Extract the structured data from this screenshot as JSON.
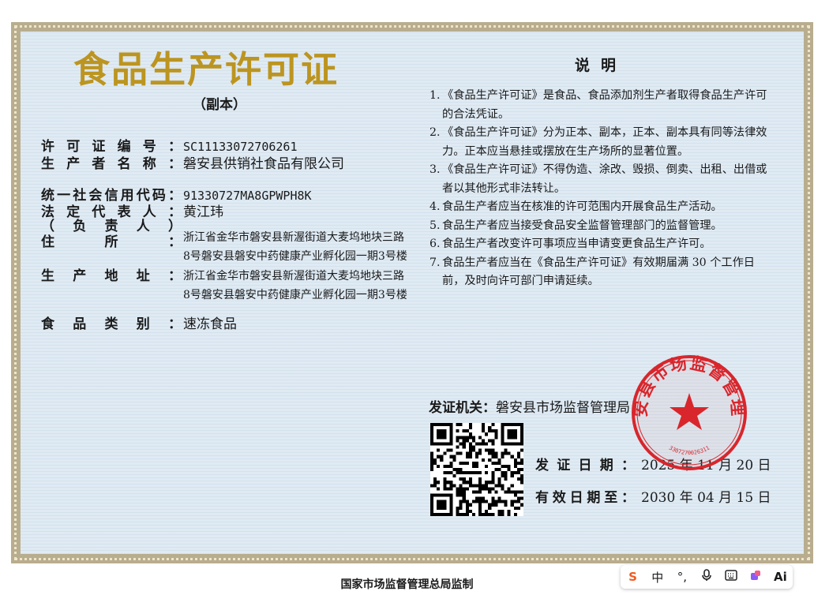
{
  "title": "食品生产许可证",
  "copy_label": "（副本）",
  "fields": [
    {
      "label": "许可证编号：",
      "value": "SC11133072706261"
    },
    {
      "label": "生产者名称：",
      "value": "磐安县供销社食品有限公司"
    },
    {
      "label": "统一社会信用代码：",
      "value": "91330727MA8GPWPH8K"
    },
    {
      "label": "法定代表人：",
      "value": "黄江玮"
    },
    {
      "label": "（负责人）",
      "value": ""
    },
    {
      "label": "住所：",
      "value_line1": "浙江省金华市磐安县新渥街道大麦坞地块三路",
      "value_line2": "8号磐安县磐安中药健康产业孵化园一期3号楼"
    },
    {
      "label": "生产地址：",
      "value_line1": "浙江省金华市磐安县新渥街道大麦坞地块三路",
      "value_line2": "8号磐安县磐安中药健康产业孵化园一期3号楼"
    },
    {
      "label": "食品类别：",
      "value": "速冻食品"
    }
  ],
  "notes_title": "说明",
  "notes": [
    {
      "num": "1.",
      "text": "《食品生产许可证》是食品、食品添加剂生产者取得食品生产许可的合法凭证。"
    },
    {
      "num": "2.",
      "text": "《食品生产许可证》分为正本、副本，正本、副本具有同等法律效力。正本应当悬挂或摆放在生产场所的显著位置。"
    },
    {
      "num": "3.",
      "text": "《食品生产许可证》不得伪造、涂改、毁损、倒卖、出租、出借或者以其他形式非法转让。"
    },
    {
      "num": "4.",
      "text": "食品生产者应当在核准的许可范围内开展食品生产活动。"
    },
    {
      "num": "5.",
      "text": "食品生产者应当接受食品安全监督管理部门的监督管理。"
    },
    {
      "num": "6.",
      "text": "食品生产者改变许可事项应当申请变更食品生产许可。"
    },
    {
      "num": "7.",
      "text": "食品生产者应当在《食品生产许可证》有效期届满 30 个工作日前，及时向许可部门申请延续。"
    }
  ],
  "issuer_label": "发证机关：",
  "issuer_value": "磐安县市场监督管理局",
  "issue_date_label": "发证日期：",
  "issue_date_value": "2025 年 11 月 20 日",
  "valid_until_label": "有效日期至：",
  "valid_until_value": "2030 年 04 月 15 日",
  "stamp": {
    "text": "磐安县市场监督管理局",
    "number": "3307270026311",
    "color": "#d8262c"
  },
  "footer": "国家市场监督管理总局监制",
  "ime_toolbar": {
    "items": [
      "S",
      "中",
      "°,",
      "mic-icon",
      "keyboard-icon",
      "skin-icon",
      "Ai"
    ]
  },
  "colors": {
    "title": "#bc9520",
    "background": "#dfeaf3",
    "border": "#b8ad8e"
  }
}
